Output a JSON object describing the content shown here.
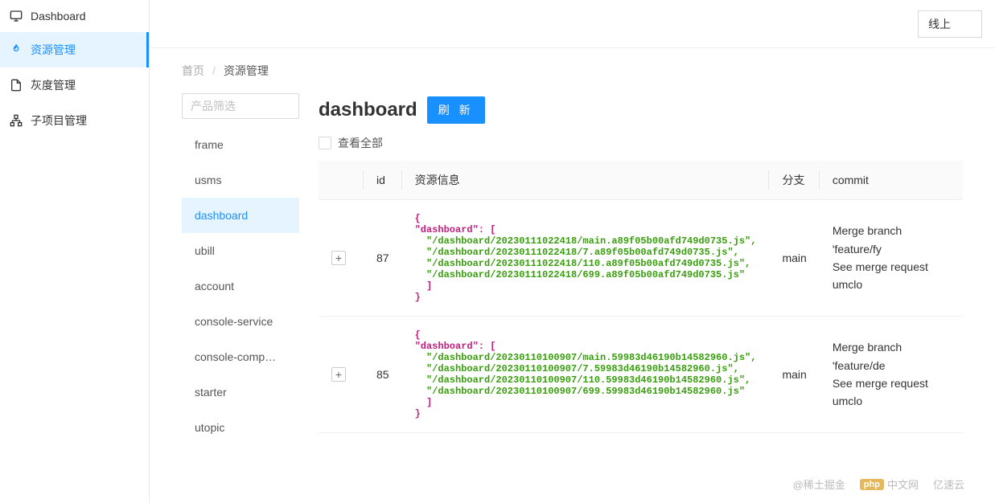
{
  "env_label": "线上",
  "sidebar": {
    "items": [
      {
        "label": "Dashboard",
        "icon": "monitor"
      },
      {
        "label": "资源管理",
        "icon": "fire",
        "active": true
      },
      {
        "label": "灰度管理",
        "icon": "file"
      },
      {
        "label": "子项目管理",
        "icon": "sitemap"
      }
    ]
  },
  "breadcrumb": {
    "home": "首页",
    "sep": "/",
    "current": "资源管理"
  },
  "product": {
    "filter_placeholder": "产品筛选",
    "items": [
      "frame",
      "usms",
      "dashboard",
      "ubill",
      "account",
      "console-service",
      "console-comp…",
      "starter",
      "utopic"
    ],
    "active_index": 2
  },
  "detail": {
    "title": "dashboard",
    "refresh_label": "刷 新",
    "view_all_label": "查看全部"
  },
  "table": {
    "headers": {
      "id": "id",
      "resource": "资源信息",
      "branch": "分支",
      "commit": "commit"
    },
    "rows": [
      {
        "id": "87",
        "resource_lines": [
          "{",
          "\"dashboard\": [",
          "  \"/dashboard/20230111022418/main.a89f05b00afd749d0735.js\",",
          "  \"/dashboard/20230111022418/7.a89f05b00afd749d0735.js\",",
          "  \"/dashboard/20230111022418/110.a89f05b00afd749d0735.js\",",
          "  \"/dashboard/20230111022418/699.a89f05b00afd749d0735.js\"",
          "  ]",
          "}"
        ],
        "branch": "main",
        "commit": "Merge branch 'feature/fy\nSee merge request umclo"
      },
      {
        "id": "85",
        "resource_lines": [
          "{",
          "\"dashboard\": [",
          "  \"/dashboard/20230110100907/main.59983d46190b14582960.js\",",
          "  \"/dashboard/20230110100907/7.59983d46190b14582960.js\",",
          "  \"/dashboard/20230110100907/110.59983d46190b14582960.js\",",
          "  \"/dashboard/20230110100907/699.59983d46190b14582960.js\"",
          "  ]",
          "}"
        ],
        "branch": "main",
        "commit": "Merge branch 'feature/de\nSee merge request umclo"
      }
    ]
  },
  "watermarks": {
    "w1": "@稀土掘金",
    "w2_badge": "php",
    "w2_text": "中文网",
    "w3": "亿速云"
  }
}
